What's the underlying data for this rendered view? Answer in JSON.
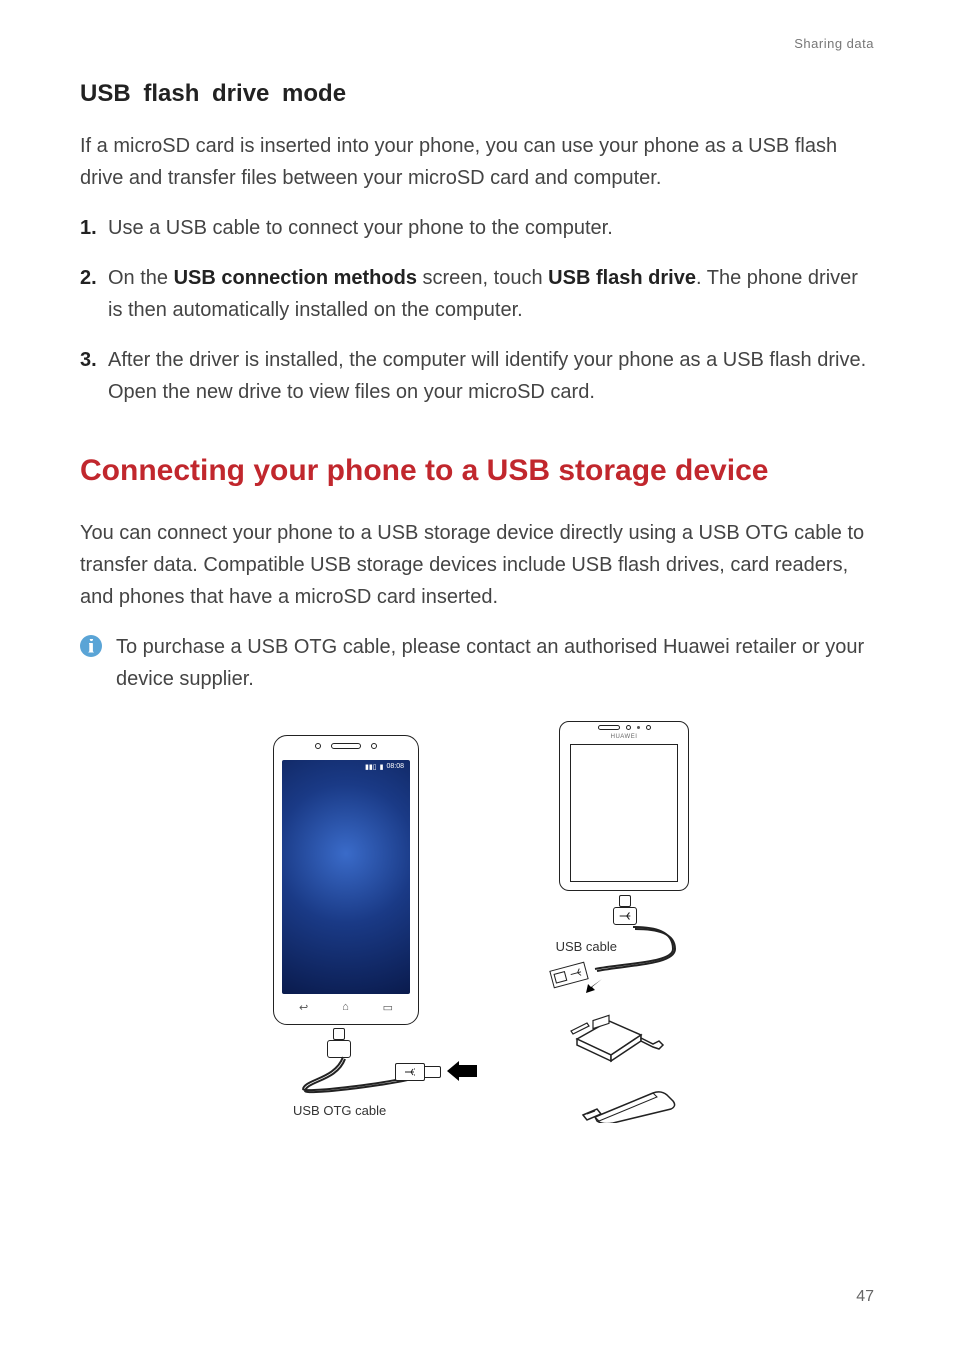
{
  "header": {
    "breadcrumb": "Sharing data"
  },
  "section1": {
    "heading": "USB flash drive mode",
    "intro": "If a microSD card is inserted into your phone, you can use your phone as a USB flash drive and transfer files between your microSD card and computer.",
    "steps": {
      "s1": "Use a USB cable to connect your phone to the computer.",
      "s2_pre": "On the ",
      "s2_b1": "USB connection methods",
      "s2_mid": " screen, touch ",
      "s2_b2": "USB flash drive",
      "s2_post": ". The phone driver is then automatically installed on the computer.",
      "s3": "After the driver is installed, the computer will identify your phone as a USB flash drive. Open the new drive to view files on your microSD card."
    }
  },
  "section2": {
    "heading": "Connecting your phone to a USB storage device",
    "para": "You can connect your phone to a USB storage device directly using a USB OTG cable to transfer data. Compatible USB storage devices include USB flash drives, card readers, and phones that have a microSD card inserted.",
    "note": "To purchase a USB OTG cable, please contact an authorised Huawei retailer or your device supplier."
  },
  "illustration": {
    "phone_time": "08:08",
    "tablet_brand": "HUAWEI",
    "otg_cable_label": "USB OTG cable",
    "usb_cable_label": "USB cable",
    "usb_glyph": "⬊"
  },
  "page_number": "47"
}
